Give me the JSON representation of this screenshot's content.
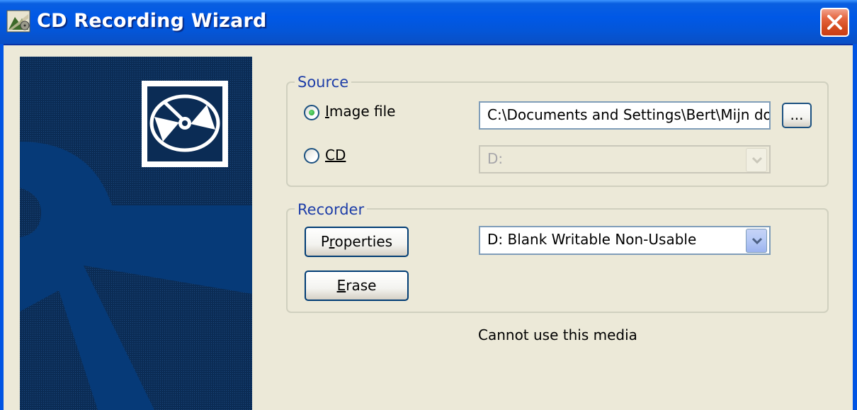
{
  "window": {
    "title": "CD Recording Wizard",
    "close_icon": "close-icon"
  },
  "source": {
    "label": "Source",
    "image_file_label": "Image file",
    "image_file_selected": true,
    "cd_label": "CD",
    "cd_selected": false,
    "image_path": "C:\\Documents and Settings\\Bert\\Mijn doc",
    "browse_label": "...",
    "cd_drive_value": "D:"
  },
  "recorder": {
    "label": "Recorder",
    "properties_label": "Properties",
    "erase_label": "Erase",
    "drive_value": "D: Blank Writable Non-Usable"
  },
  "status_text": "Cannot use this media",
  "colors": {
    "title_bar": "#0058e6",
    "banner": "#0a2a52",
    "dialog_bg": "#ece9d8",
    "group_label": "#1e3ea8"
  }
}
